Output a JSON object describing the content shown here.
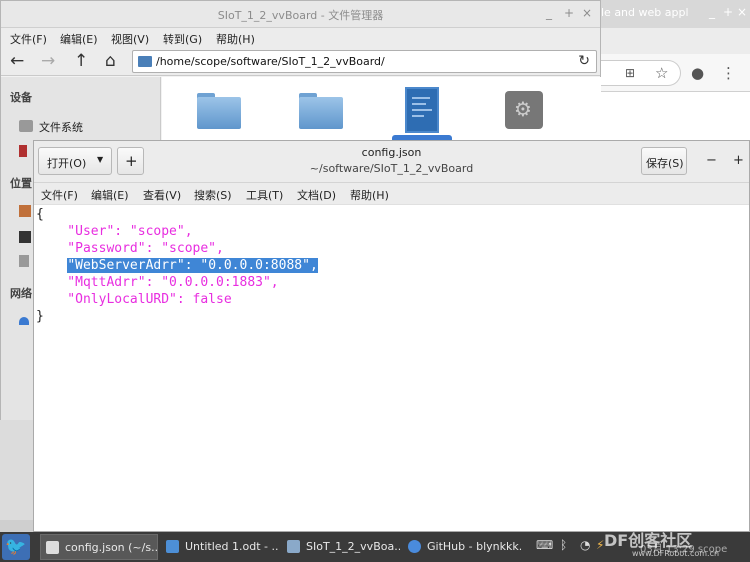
{
  "browser": {
    "tab_title": "le and web appl",
    "new_tab_label": "",
    "controls": [
      "_",
      "+",
      "×"
    ]
  },
  "file_manager": {
    "title": "SIoT_1_2_vvBoard - 文件管理器",
    "controls": [
      "_",
      "+",
      "×"
    ],
    "menu": [
      "文件(F)",
      "编辑(E)",
      "视图(V)",
      "转到(G)",
      "帮助(H)"
    ],
    "path": "/home/scope/software/SIoT_1_2_vvBoard/",
    "sidebar": {
      "devices_header": "设备",
      "filesystem": "文件系统",
      "places_header": "位置",
      "network_header": "网络"
    }
  },
  "editor": {
    "open_button": "打开(O)",
    "new_button": "+",
    "title": "config.json",
    "subtitle": "~/software/SIoT_1_2_vvBoard",
    "save_button": "保存(S)",
    "minimize": "−",
    "maximize": "+",
    "menu": [
      "文件(F)",
      "编辑(E)",
      "查看(V)",
      "搜索(S)",
      "工具(T)",
      "文档(D)",
      "帮助(H)"
    ],
    "content": {
      "open_brace": "{",
      "line_user": "    \"User\": \"scope\",",
      "line_password": "    \"Password\": \"scope\",",
      "line_web_selected": "\"WebServerAdrr\": \"0.0.0.0:8088\",",
      "line_web_indent": "    ",
      "line_mqtt": "    \"MqttAdrr\": \"0.0.0.0:1883\",",
      "line_local": "    \"OnlyLocalURD\": false",
      "close_brace": "}"
    }
  },
  "taskbar": {
    "items": [
      {
        "label": "config.json (~/s..."
      },
      {
        "label": "Untitled 1.odt - ..."
      },
      {
        "label": "SIoT_1_2_vvBoa..."
      },
      {
        "label": "GitHub - blynkkk..."
      }
    ],
    "clock": "03月 13:29 scope",
    "watermark": "DF创客社区",
    "watermark_url": "www.DFRobot.com.cn"
  },
  "colors": {
    "json_key": "#e82ee0",
    "selection": "#3f86d6",
    "taskbar": "#3a3a3a"
  }
}
